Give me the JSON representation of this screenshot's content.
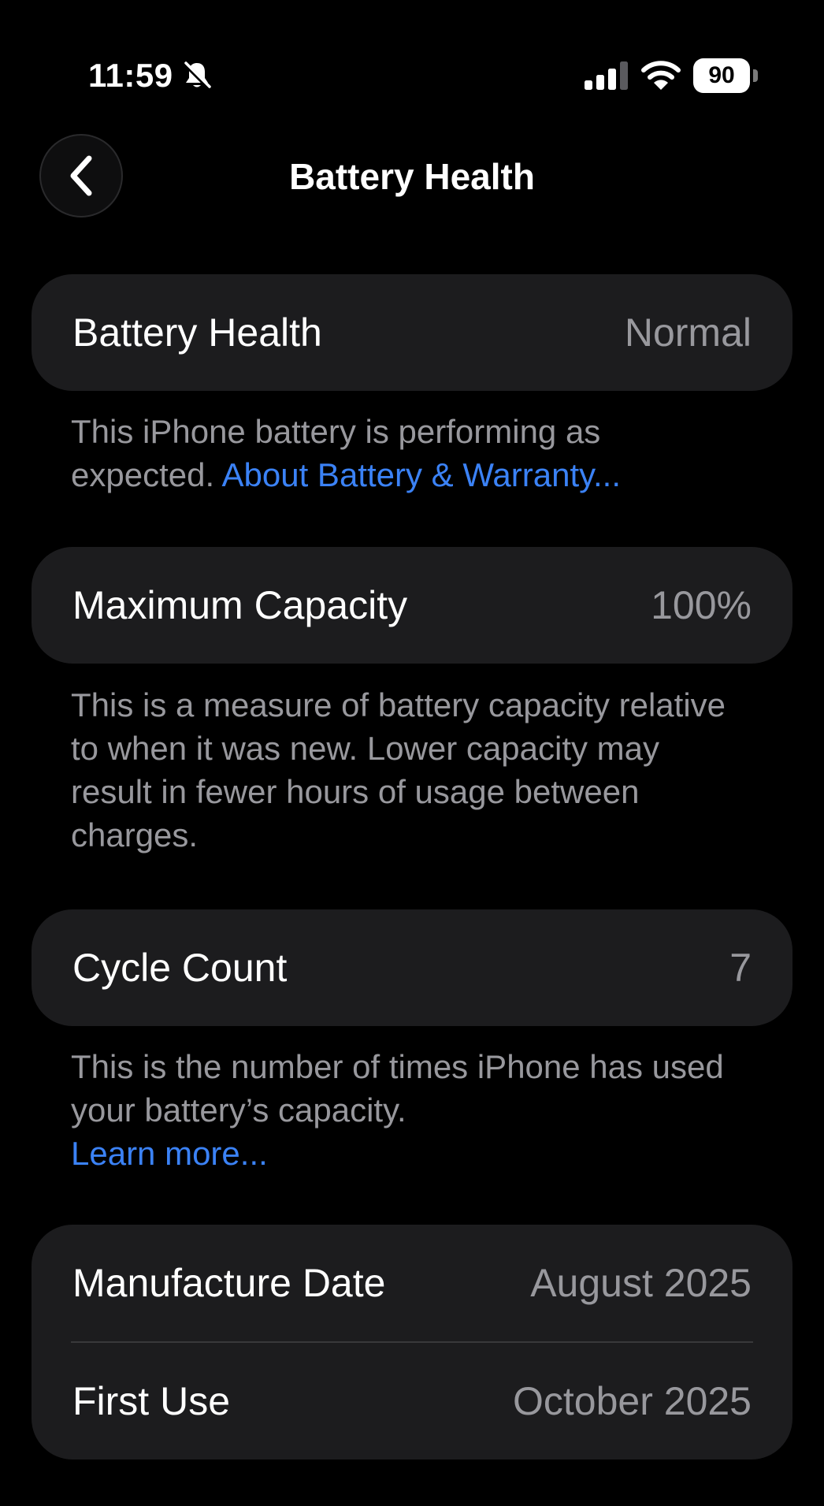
{
  "status_bar": {
    "time": "11:59",
    "battery_level": "90",
    "icons": [
      "bell-slash-icon",
      "cellular-signal-icon",
      "wifi-icon",
      "battery-icon"
    ]
  },
  "nav": {
    "title": "Battery Health",
    "back_icon": "chevron-left-icon"
  },
  "sections": {
    "battery_health": {
      "label": "Battery Health",
      "value": "Normal",
      "footnote": "This iPhone battery is performing as expected.",
      "link": "About Battery & Warranty..."
    },
    "maximum_capacity": {
      "label": "Maximum Capacity",
      "value": "100%",
      "footnote": "This is a measure of battery capacity relative to when it was new. Lower capacity may result in fewer hours of usage between charges."
    },
    "cycle_count": {
      "label": "Cycle Count",
      "value": "7",
      "footnote": "This is the number of times iPhone has used your battery’s capacity.",
      "link": "Learn more..."
    },
    "dates": {
      "manufacture_label": "Manufacture Date",
      "manufacture_value": "August 2025",
      "first_use_label": "First Use",
      "first_use_value": "October 2025"
    }
  },
  "colors": {
    "background": "#000000",
    "card": "#1c1c1e",
    "secondary_text": "#98989d",
    "link": "#3b82f6"
  }
}
